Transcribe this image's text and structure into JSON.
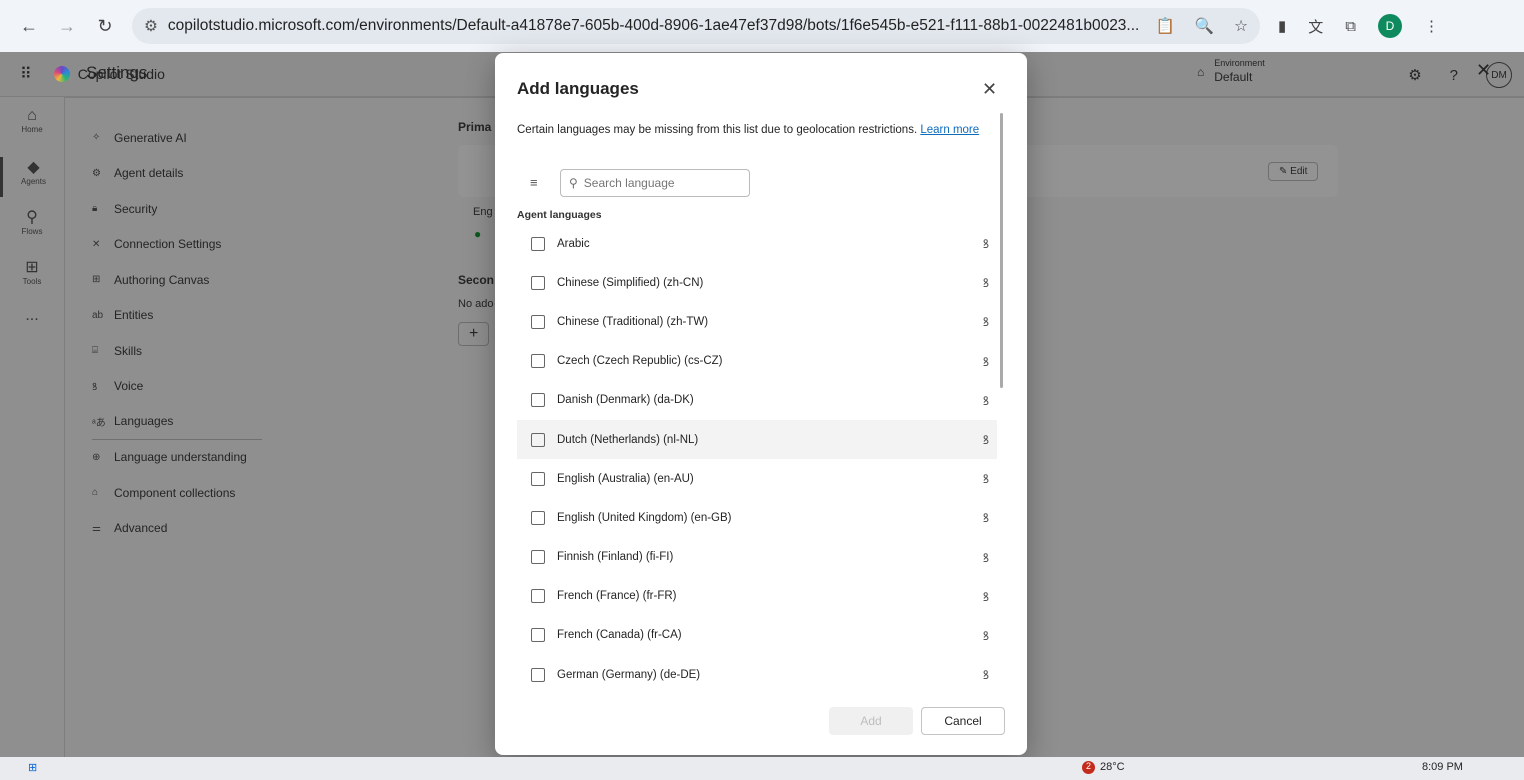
{
  "browser": {
    "url": "copilotstudio.microsoft.com/environments/Default-a41878e7-605b-400d-8906-1ae47ef37d98/bots/1f6e545b-e521-f111-88b1-0022481b0023...",
    "profile": "D"
  },
  "app": {
    "name": "Copilot Studio",
    "environment_label": "Environment",
    "environment": "Default",
    "user_initials": "DM"
  },
  "rail": [
    {
      "label": "Home"
    },
    {
      "label": "Agents"
    },
    {
      "label": "Flows"
    },
    {
      "label": "Tools"
    },
    {
      "label": "..."
    }
  ],
  "settings": {
    "title": "Settings",
    "nav": [
      "Generative AI",
      "Agent details",
      "Security",
      "Connection Settings",
      "Authoring Canvas",
      "Entities",
      "Skills",
      "Voice",
      "Languages",
      "Language understanding",
      "Component collections",
      "Advanced"
    ],
    "primary": "Prima",
    "eng": "Eng",
    "secondary": "Secon",
    "no_add": "No ado",
    "edit": "Edit"
  },
  "modal": {
    "title": "Add languages",
    "description": "Certain languages may be missing from this list due to geolocation restrictions.",
    "learn_more": "Learn more",
    "search_placeholder": "Search language",
    "section": "Agent languages",
    "languages": [
      "Arabic",
      "Chinese (Simplified) (zh-CN)",
      "Chinese (Traditional) (zh-TW)",
      "Czech (Czech Republic) (cs-CZ)",
      "Danish (Denmark) (da-DK)",
      "Dutch (Netherlands) (nl-NL)",
      "English (Australia) (en-AU)",
      "English (United Kingdom) (en-GB)",
      "Finnish (Finland) (fi-FI)",
      "French (France) (fr-FR)",
      "French (Canada) (fr-CA)",
      "German (Germany) (de-DE)"
    ],
    "add": "Add",
    "cancel": "Cancel"
  },
  "taskbar": {
    "weather": "28°C",
    "badge": "2",
    "time": "8:09 PM"
  }
}
